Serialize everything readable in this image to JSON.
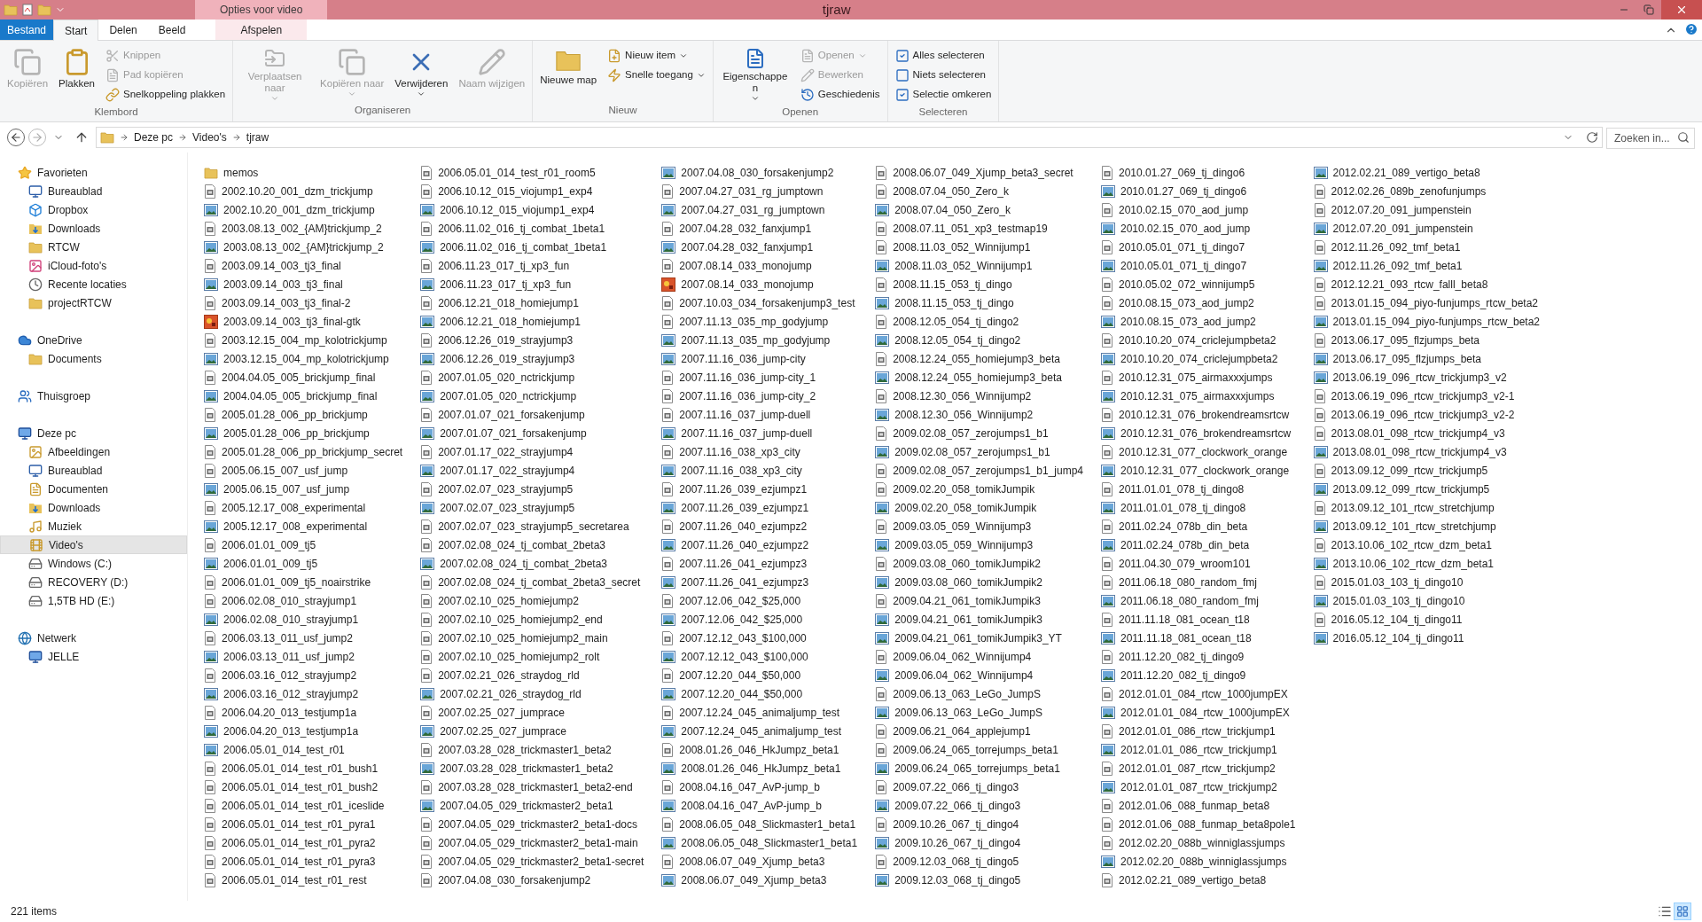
{
  "window": {
    "title": "tjraw",
    "context_label": "Opties voor video"
  },
  "tabs": [
    {
      "label": "Bestand",
      "kind": "file",
      "selected": false
    },
    {
      "label": "Start",
      "kind": "tab",
      "selected": true
    },
    {
      "label": "Delen",
      "kind": "tab",
      "selected": false
    },
    {
      "label": "Beeld",
      "kind": "tab",
      "selected": false
    },
    {
      "label": "Afspelen",
      "kind": "context",
      "selected": false
    }
  ],
  "ribbon": {
    "groups": [
      {
        "label": "Klembord",
        "buttons": [
          {
            "label": "Kopiëren",
            "kind": "large",
            "disabled": true,
            "menu": false
          },
          {
            "label": "Plakken",
            "kind": "large",
            "disabled": false,
            "menu": false
          },
          {
            "label": "Knippen",
            "kind": "small",
            "disabled": true,
            "menu": false
          },
          {
            "label": "Pad kopiëren",
            "kind": "small",
            "disabled": true,
            "menu": false
          },
          {
            "label": "Snelkoppeling plakken",
            "kind": "small",
            "disabled": false,
            "menu": false
          }
        ]
      },
      {
        "label": "Organiseren",
        "buttons": [
          {
            "label": "Verplaatsen naar",
            "kind": "large",
            "disabled": true,
            "menu": true
          },
          {
            "label": "Kopiëren naar",
            "kind": "large",
            "disabled": true,
            "menu": true
          },
          {
            "label": "Verwijderen",
            "kind": "large",
            "disabled": false,
            "menu": true
          },
          {
            "label": "Naam wijzigen",
            "kind": "large",
            "disabled": true,
            "menu": false
          }
        ]
      },
      {
        "label": "Nieuw",
        "buttons": [
          {
            "label": "Nieuwe map",
            "kind": "large",
            "disabled": false,
            "menu": false
          },
          {
            "label": "Nieuw item",
            "kind": "small",
            "disabled": false,
            "menu": true
          },
          {
            "label": "Snelle toegang",
            "kind": "small",
            "disabled": false,
            "menu": true
          }
        ]
      },
      {
        "label": "Openen",
        "buttons": [
          {
            "label": "Eigenschappen",
            "kind": "large",
            "disabled": false,
            "menu": true
          },
          {
            "label": "Openen",
            "kind": "small",
            "disabled": true,
            "menu": true
          },
          {
            "label": "Bewerken",
            "kind": "small",
            "disabled": true,
            "menu": false
          },
          {
            "label": "Geschiedenis",
            "kind": "small",
            "disabled": false,
            "menu": false
          }
        ]
      },
      {
        "label": "Selecteren",
        "buttons": [
          {
            "label": "Alles selecteren",
            "kind": "small",
            "disabled": false,
            "menu": false
          },
          {
            "label": "Niets selecteren",
            "kind": "small",
            "disabled": false,
            "menu": false
          },
          {
            "label": "Selectie omkeren",
            "kind": "small",
            "disabled": false,
            "menu": false
          }
        ]
      }
    ]
  },
  "address_bar": {
    "crumbs": [
      "Deze pc",
      "Video's",
      "tjraw"
    ],
    "search": {
      "placeholder": "Zoeken in..."
    }
  },
  "sidebar": {
    "sections": [
      {
        "label": "Favorieten",
        "kind": "star",
        "selected": false,
        "children": [
          {
            "label": "Bureaublad",
            "kind": "desktop",
            "selected": false
          },
          {
            "label": "Dropbox",
            "kind": "dropbox",
            "selected": false
          },
          {
            "label": "Downloads",
            "kind": "downloads",
            "selected": false
          },
          {
            "label": "RTCW",
            "kind": "folder",
            "selected": false
          },
          {
            "label": "iCloud-foto's",
            "kind": "photos",
            "selected": false
          },
          {
            "label": "Recente locaties",
            "kind": "recent",
            "selected": false
          },
          {
            "label": "projectRTCW",
            "kind": "folder",
            "selected": false
          }
        ]
      },
      {
        "label": "OneDrive",
        "kind": "cloud",
        "selected": false,
        "children": [
          {
            "label": "Documents",
            "kind": "folder",
            "selected": false
          }
        ]
      },
      {
        "label": "Thuisgroep",
        "kind": "homegroup",
        "selected": false
      },
      {
        "label": "Deze pc",
        "kind": "pc",
        "selected": false,
        "children": [
          {
            "label": "Afbeeldingen",
            "kind": "pictures",
            "selected": false
          },
          {
            "label": "Bureaublad",
            "kind": "desktop",
            "selected": false
          },
          {
            "label": "Documenten",
            "kind": "documents",
            "selected": false
          },
          {
            "label": "Downloads",
            "kind": "downloads",
            "selected": false
          },
          {
            "label": "Muziek",
            "kind": "music",
            "selected": false
          },
          {
            "label": "Video's",
            "kind": "videos",
            "selected": true
          },
          {
            "label": "Windows (C:)",
            "kind": "windrive",
            "selected": false
          },
          {
            "label": "RECOVERY (D:)",
            "kind": "drive",
            "selected": false
          },
          {
            "label": "1,5TB HD (E:)",
            "kind": "drive",
            "selected": false
          }
        ]
      },
      {
        "label": "Netwerk",
        "kind": "network",
        "selected": false,
        "children": [
          {
            "label": "JELLE",
            "kind": "computer",
            "selected": false
          }
        ]
      }
    ]
  },
  "files": [
    {
      "name": "memos",
      "kind": "folder"
    },
    {
      "name": "2002.10.20_001_dzm_trickjump",
      "kind": "file"
    },
    {
      "name": "2002.10.20_001_dzm_trickjump",
      "kind": "image"
    },
    {
      "name": "2003.08.13_002_{AM}trickjump_2",
      "kind": "file"
    },
    {
      "name": "2003.08.13_002_{AM}trickjump_2",
      "kind": "image"
    },
    {
      "name": "2003.09.14_003_tj3_final",
      "kind": "file"
    },
    {
      "name": "2003.09.14_003_tj3_final",
      "kind": "image"
    },
    {
      "name": "2003.09.14_003_tj3_final-2",
      "kind": "file"
    },
    {
      "name": "2003.09.14_003_tj3_final-gtk",
      "kind": "app"
    },
    {
      "name": "2003.12.15_004_mp_kolotrickjump",
      "kind": "file"
    },
    {
      "name": "2003.12.15_004_mp_kolotrickjump",
      "kind": "image"
    },
    {
      "name": "2004.04.05_005_brickjump_final",
      "kind": "file"
    },
    {
      "name": "2004.04.05_005_brickjump_final",
      "kind": "image"
    },
    {
      "name": "2005.01.28_006_pp_brickjump",
      "kind": "file"
    },
    {
      "name": "2005.01.28_006_pp_brickjump",
      "kind": "image"
    },
    {
      "name": "2005.01.28_006_pp_brickjump_secret",
      "kind": "file"
    },
    {
      "name": "2005.06.15_007_usf_jump",
      "kind": "file"
    },
    {
      "name": "2005.06.15_007_usf_jump",
      "kind": "image"
    },
    {
      "name": "2005.12.17_008_experimental",
      "kind": "file"
    },
    {
      "name": "2005.12.17_008_experimental",
      "kind": "image"
    },
    {
      "name": "2006.01.01_009_tj5",
      "kind": "file"
    },
    {
      "name": "2006.01.01_009_tj5",
      "kind": "image"
    },
    {
      "name": "2006.01.01_009_tj5_noairstrike",
      "kind": "file"
    },
    {
      "name": "2006.02.08_010_strayjump1",
      "kind": "file"
    },
    {
      "name": "2006.02.08_010_strayjump1",
      "kind": "image"
    },
    {
      "name": "2006.03.13_011_usf_jump2",
      "kind": "file"
    },
    {
      "name": "2006.03.13_011_usf_jump2",
      "kind": "image"
    },
    {
      "name": "2006.03.16_012_strayjump2",
      "kind": "file"
    },
    {
      "name": "2006.03.16_012_strayjump2",
      "kind": "image"
    },
    {
      "name": "2006.04.20_013_testjump1a",
      "kind": "file"
    },
    {
      "name": "2006.04.20_013_testjump1a",
      "kind": "image"
    },
    {
      "name": "2006.05.01_014_test_r01",
      "kind": "image"
    },
    {
      "name": "2006.05.01_014_test_r01_bush1",
      "kind": "file"
    },
    {
      "name": "2006.05.01_014_test_r01_bush2",
      "kind": "file"
    },
    {
      "name": "2006.05.01_014_test_r01_iceslide",
      "kind": "file"
    },
    {
      "name": "2006.05.01_014_test_r01_pyra1",
      "kind": "file"
    },
    {
      "name": "2006.05.01_014_test_r01_pyra2",
      "kind": "file"
    },
    {
      "name": "2006.05.01_014_test_r01_pyra3",
      "kind": "file"
    },
    {
      "name": "2006.05.01_014_test_r01_rest",
      "kind": "file"
    },
    {
      "name": "2006.05.01_014_test_r01_room5",
      "kind": "file"
    },
    {
      "name": "2006.10.12_015_viojump1_exp4",
      "kind": "file"
    },
    {
      "name": "2006.10.12_015_viojump1_exp4",
      "kind": "image"
    },
    {
      "name": "2006.11.02_016_tj_combat_1beta1",
      "kind": "file"
    },
    {
      "name": "2006.11.02_016_tj_combat_1beta1",
      "kind": "image"
    },
    {
      "name": "2006.11.23_017_tj_xp3_fun",
      "kind": "file"
    },
    {
      "name": "2006.11.23_017_tj_xp3_fun",
      "kind": "image"
    },
    {
      "name": "2006.12.21_018_homiejump1",
      "kind": "file"
    },
    {
      "name": "2006.12.21_018_homiejump1",
      "kind": "image"
    },
    {
      "name": "2006.12.26_019_strayjump3",
      "kind": "file"
    },
    {
      "name": "2006.12.26_019_strayjump3",
      "kind": "image"
    },
    {
      "name": "2007.01.05_020_nctrickjump",
      "kind": "file"
    },
    {
      "name": "2007.01.05_020_nctrickjump",
      "kind": "image"
    },
    {
      "name": "2007.01.07_021_forsakenjump",
      "kind": "file"
    },
    {
      "name": "2007.01.07_021_forsakenjump",
      "kind": "image"
    },
    {
      "name": "2007.01.17_022_strayjump4",
      "kind": "file"
    },
    {
      "name": "2007.01.17_022_strayjump4",
      "kind": "image"
    },
    {
      "name": "2007.02.07_023_strayjump5",
      "kind": "file"
    },
    {
      "name": "2007.02.07_023_strayjump5",
      "kind": "image"
    },
    {
      "name": "2007.02.07_023_strayjump5_secretarea",
      "kind": "file"
    },
    {
      "name": "2007.02.08_024_tj_combat_2beta3",
      "kind": "file"
    },
    {
      "name": "2007.02.08_024_tj_combat_2beta3",
      "kind": "image"
    },
    {
      "name": "2007.02.08_024_tj_combat_2beta3_secret",
      "kind": "file"
    },
    {
      "name": "2007.02.10_025_homiejump2",
      "kind": "file"
    },
    {
      "name": "2007.02.10_025_homiejump2_end",
      "kind": "file"
    },
    {
      "name": "2007.02.10_025_homiejump2_main",
      "kind": "file"
    },
    {
      "name": "2007.02.10_025_homiejump2_rolt",
      "kind": "file"
    },
    {
      "name": "2007.02.21_026_straydog_rld",
      "kind": "file"
    },
    {
      "name": "2007.02.21_026_straydog_rld",
      "kind": "image"
    },
    {
      "name": "2007.02.25_027_jumprace",
      "kind": "file"
    },
    {
      "name": "2007.02.25_027_jumprace",
      "kind": "image"
    },
    {
      "name": "2007.03.28_028_trickmaster1_beta2",
      "kind": "file"
    },
    {
      "name": "2007.03.28_028_trickmaster1_beta2",
      "kind": "image"
    },
    {
      "name": "2007.03.28_028_trickmaster1_beta2-end",
      "kind": "file"
    },
    {
      "name": "2007.04.05_029_trickmaster2_beta1",
      "kind": "image"
    },
    {
      "name": "2007.04.05_029_trickmaster2_beta1-docs",
      "kind": "file"
    },
    {
      "name": "2007.04.05_029_trickmaster2_beta1-main",
      "kind": "file"
    },
    {
      "name": "2007.04.05_029_trickmaster2_beta1-secret",
      "kind": "file"
    },
    {
      "name": "2007.04.08_030_forsakenjump2",
      "kind": "file"
    },
    {
      "name": "2007.04.08_030_forsakenjump2",
      "kind": "image"
    },
    {
      "name": "2007.04.27_031_rg_jumptown",
      "kind": "file"
    },
    {
      "name": "2007.04.27_031_rg_jumptown",
      "kind": "image"
    },
    {
      "name": "2007.04.28_032_fanxjump1",
      "kind": "file"
    },
    {
      "name": "2007.04.28_032_fanxjump1",
      "kind": "image"
    },
    {
      "name": "2007.08.14_033_monojump",
      "kind": "file"
    },
    {
      "name": "2007.08.14_033_monojump",
      "kind": "app"
    },
    {
      "name": "2007.10.03_034_forsakenjump3_test",
      "kind": "file"
    },
    {
      "name": "2007.11.13_035_mp_godyjump",
      "kind": "file"
    },
    {
      "name": "2007.11.13_035_mp_godyjump",
      "kind": "image"
    },
    {
      "name": "2007.11.16_036_jump-city",
      "kind": "image"
    },
    {
      "name": "2007.11.16_036_jump-city_1",
      "kind": "file"
    },
    {
      "name": "2007.11.16_036_jump-city_2",
      "kind": "file"
    },
    {
      "name": "2007.11.16_037_jump-duell",
      "kind": "file"
    },
    {
      "name": "2007.11.16_037_jump-duell",
      "kind": "image"
    },
    {
      "name": "2007.11.16_038_xp3_city",
      "kind": "file"
    },
    {
      "name": "2007.11.16_038_xp3_city",
      "kind": "image"
    },
    {
      "name": "2007.11.26_039_ezjumpz1",
      "kind": "file"
    },
    {
      "name": "2007.11.26_039_ezjumpz1",
      "kind": "image"
    },
    {
      "name": "2007.11.26_040_ezjumpz2",
      "kind": "file"
    },
    {
      "name": "2007.11.26_040_ezjumpz2",
      "kind": "image"
    },
    {
      "name": "2007.11.26_041_ezjumpz3",
      "kind": "file"
    },
    {
      "name": "2007.11.26_041_ezjumpz3",
      "kind": "image"
    },
    {
      "name": "2007.12.06_042_$25,000",
      "kind": "file"
    },
    {
      "name": "2007.12.06_042_$25,000",
      "kind": "image"
    },
    {
      "name": "2007.12.12_043_$100,000",
      "kind": "file"
    },
    {
      "name": "2007.12.12_043_$100,000",
      "kind": "image"
    },
    {
      "name": "2007.12.20_044_$50,000",
      "kind": "file"
    },
    {
      "name": "2007.12.20_044_$50,000",
      "kind": "image"
    },
    {
      "name": "2007.12.24_045_animaljump_test",
      "kind": "file"
    },
    {
      "name": "2007.12.24_045_animaljump_test",
      "kind": "image"
    },
    {
      "name": "2008.01.26_046_HkJumpz_beta1",
      "kind": "file"
    },
    {
      "name": "2008.01.26_046_HkJumpz_beta1",
      "kind": "image"
    },
    {
      "name": "2008.04.16_047_AvP-jump_b",
      "kind": "file"
    },
    {
      "name": "2008.04.16_047_AvP-jump_b",
      "kind": "image"
    },
    {
      "name": "2008.06.05_048_Slickmaster1_beta1",
      "kind": "file"
    },
    {
      "name": "2008.06.05_048_Slickmaster1_beta1",
      "kind": "image"
    },
    {
      "name": "2008.06.07_049_Xjump_beta3",
      "kind": "file"
    },
    {
      "name": "2008.06.07_049_Xjump_beta3",
      "kind": "image"
    },
    {
      "name": "2008.06.07_049_Xjump_beta3_secret",
      "kind": "file"
    },
    {
      "name": "2008.07.04_050_Zero_k",
      "kind": "file"
    },
    {
      "name": "2008.07.04_050_Zero_k",
      "kind": "image"
    },
    {
      "name": "2008.07.11_051_xp3_testmap19",
      "kind": "file"
    },
    {
      "name": "2008.11.03_052_Winnijump1",
      "kind": "file"
    },
    {
      "name": "2008.11.03_052_Winnijump1",
      "kind": "image"
    },
    {
      "name": "2008.11.15_053_tj_dingo",
      "kind": "file"
    },
    {
      "name": "2008.11.15_053_tj_dingo",
      "kind": "image"
    },
    {
      "name": "2008.12.05_054_tj_dingo2",
      "kind": "file"
    },
    {
      "name": "2008.12.05_054_tj_dingo2",
      "kind": "image"
    },
    {
      "name": "2008.12.24_055_homiejump3_beta",
      "kind": "file"
    },
    {
      "name": "2008.12.24_055_homiejump3_beta",
      "kind": "image"
    },
    {
      "name": "2008.12.30_056_Winnijump2",
      "kind": "file"
    },
    {
      "name": "2008.12.30_056_Winnijump2",
      "kind": "image"
    },
    {
      "name": "2009.02.08_057_zerojumps1_b1",
      "kind": "file"
    },
    {
      "name": "2009.02.08_057_zerojumps1_b1",
      "kind": "image"
    },
    {
      "name": "2009.02.08_057_zerojumps1_b1_jump4",
      "kind": "file"
    },
    {
      "name": "2009.02.20_058_tomikJumpik",
      "kind": "file"
    },
    {
      "name": "2009.02.20_058_tomikJumpik",
      "kind": "image"
    },
    {
      "name": "2009.03.05_059_Winnijump3",
      "kind": "file"
    },
    {
      "name": "2009.03.05_059_Winnijump3",
      "kind": "image"
    },
    {
      "name": "2009.03.08_060_tomikJumpik2",
      "kind": "file"
    },
    {
      "name": "2009.03.08_060_tomikJumpik2",
      "kind": "image"
    },
    {
      "name": "2009.04.21_061_tomikJumpik3",
      "kind": "file"
    },
    {
      "name": "2009.04.21_061_tomikJumpik3",
      "kind": "image"
    },
    {
      "name": "2009.04.21_061_tomikJumpik3_YT",
      "kind": "image"
    },
    {
      "name": "2009.06.04_062_Winnijump4",
      "kind": "file"
    },
    {
      "name": "2009.06.04_062_Winnijump4",
      "kind": "image"
    },
    {
      "name": "2009.06.13_063_LeGo_JumpS",
      "kind": "file"
    },
    {
      "name": "2009.06.13_063_LeGo_JumpS",
      "kind": "image"
    },
    {
      "name": "2009.06.21_064_applejump1",
      "kind": "file"
    },
    {
      "name": "2009.06.24_065_torrejumps_beta1",
      "kind": "file"
    },
    {
      "name": "2009.06.24_065_torrejumps_beta1",
      "kind": "image"
    },
    {
      "name": "2009.07.22_066_tj_dingo3",
      "kind": "file"
    },
    {
      "name": "2009.07.22_066_tj_dingo3",
      "kind": "image"
    },
    {
      "name": "2009.10.26_067_tj_dingo4",
      "kind": "file"
    },
    {
      "name": "2009.10.26_067_tj_dingo4",
      "kind": "image"
    },
    {
      "name": "2009.12.03_068_tj_dingo5",
      "kind": "file"
    },
    {
      "name": "2009.12.03_068_tj_dingo5",
      "kind": "image"
    },
    {
      "name": "2010.01.27_069_tj_dingo6",
      "kind": "file"
    },
    {
      "name": "2010.01.27_069_tj_dingo6",
      "kind": "image"
    },
    {
      "name": "2010.02.15_070_aod_jump",
      "kind": "file"
    },
    {
      "name": "2010.02.15_070_aod_jump",
      "kind": "image"
    },
    {
      "name": "2010.05.01_071_tj_dingo7",
      "kind": "file"
    },
    {
      "name": "2010.05.01_071_tj_dingo7",
      "kind": "image"
    },
    {
      "name": "2010.05.02_072_winnijump5",
      "kind": "file"
    },
    {
      "name": "2010.08.15_073_aod_jump2",
      "kind": "file"
    },
    {
      "name": "2010.08.15_073_aod_jump2",
      "kind": "image"
    },
    {
      "name": "2010.10.20_074_criclejumpbeta2",
      "kind": "file"
    },
    {
      "name": "2010.10.20_074_criclejumpbeta2",
      "kind": "image"
    },
    {
      "name": "2010.12.31_075_airmaxxxjumps",
      "kind": "file"
    },
    {
      "name": "2010.12.31_075_airmaxxxjumps",
      "kind": "image"
    },
    {
      "name": "2010.12.31_076_brokendreamsrtcw",
      "kind": "file"
    },
    {
      "name": "2010.12.31_076_brokendreamsrtcw",
      "kind": "image"
    },
    {
      "name": "2010.12.31_077_clockwork_orange",
      "kind": "file"
    },
    {
      "name": "2010.12.31_077_clockwork_orange",
      "kind": "image"
    },
    {
      "name": "2011.01.01_078_tj_dingo8",
      "kind": "file"
    },
    {
      "name": "2011.01.01_078_tj_dingo8",
      "kind": "image"
    },
    {
      "name": "2011.02.24_078b_din_beta",
      "kind": "file"
    },
    {
      "name": "2011.02.24_078b_din_beta",
      "kind": "image"
    },
    {
      "name": "2011.04.30_079_wroom101",
      "kind": "file"
    },
    {
      "name": "2011.06.18_080_random_fmj",
      "kind": "file"
    },
    {
      "name": "2011.06.18_080_random_fmj",
      "kind": "image"
    },
    {
      "name": "2011.11.18_081_ocean_t18",
      "kind": "file"
    },
    {
      "name": "2011.11.18_081_ocean_t18",
      "kind": "image"
    },
    {
      "name": "2011.12.20_082_tj_dingo9",
      "kind": "file"
    },
    {
      "name": "2011.12.20_082_tj_dingo9",
      "kind": "image"
    },
    {
      "name": "2012.01.01_084_rtcw_1000jumpEX",
      "kind": "file"
    },
    {
      "name": "2012.01.01_084_rtcw_1000jumpEX",
      "kind": "image"
    },
    {
      "name": "2012.01.01_086_rtcw_trickjump1",
      "kind": "file"
    },
    {
      "name": "2012.01.01_086_rtcw_trickjump1",
      "kind": "image"
    },
    {
      "name": "2012.01.01_087_rtcw_trickjump2",
      "kind": "file"
    },
    {
      "name": "2012.01.01_087_rtcw_trickjump2",
      "kind": "image"
    },
    {
      "name": "2012.01.06_088_funmap_beta8",
      "kind": "file"
    },
    {
      "name": "2012.01.06_088_funmap_beta8pole1",
      "kind": "file"
    },
    {
      "name": "2012.02.20_088b_winniglassjumps",
      "kind": "file"
    },
    {
      "name": "2012.02.20_088b_winniglassjumps",
      "kind": "image"
    },
    {
      "name": "2012.02.21_089_vertigo_beta8",
      "kind": "file"
    },
    {
      "name": "2012.02.21_089_vertigo_beta8",
      "kind": "image"
    },
    {
      "name": "2012.02.26_089b_zenofunjumps",
      "kind": "file"
    },
    {
      "name": "2012.07.20_091_jumpenstein",
      "kind": "file"
    },
    {
      "name": "2012.07.20_091_jumpenstein",
      "kind": "image"
    },
    {
      "name": "2012.11.26_092_tmf_beta1",
      "kind": "file"
    },
    {
      "name": "2012.11.26_092_tmf_beta1",
      "kind": "image"
    },
    {
      "name": "2012.12.21_093_rtcw_falll_beta8",
      "kind": "file"
    },
    {
      "name": "2013.01.15_094_piyo-funjumps_rtcw_beta2",
      "kind": "file"
    },
    {
      "name": "2013.01.15_094_piyo-funjumps_rtcw_beta2",
      "kind": "image"
    },
    {
      "name": "2013.06.17_095_flzjumps_beta",
      "kind": "file"
    },
    {
      "name": "2013.06.17_095_flzjumps_beta",
      "kind": "image"
    },
    {
      "name": "2013.06.19_096_rtcw_trickjump3_v2",
      "kind": "image"
    },
    {
      "name": "2013.06.19_096_rtcw_trickjump3_v2-1",
      "kind": "file"
    },
    {
      "name": "2013.06.19_096_rtcw_trickjump3_v2-2",
      "kind": "file"
    },
    {
      "name": "2013.08.01_098_rtcw_trickjump4_v3",
      "kind": "file"
    },
    {
      "name": "2013.08.01_098_rtcw_trickjump4_v3",
      "kind": "image"
    },
    {
      "name": "2013.09.12_099_rtcw_trickjump5",
      "kind": "file"
    },
    {
      "name": "2013.09.12_099_rtcw_trickjump5",
      "kind": "image"
    },
    {
      "name": "2013.09.12_101_rtcw_stretchjump",
      "kind": "file"
    },
    {
      "name": "2013.09.12_101_rtcw_stretchjump",
      "kind": "image"
    },
    {
      "name": "2013.10.06_102_rtcw_dzm_beta1",
      "kind": "file"
    },
    {
      "name": "2013.10.06_102_rtcw_dzm_beta1",
      "kind": "image"
    },
    {
      "name": "2015.01.03_103_tj_dingo10",
      "kind": "file"
    },
    {
      "name": "2015.01.03_103_tj_dingo10",
      "kind": "image"
    },
    {
      "name": "2016.05.12_104_tj_dingo11",
      "kind": "file"
    },
    {
      "name": "2016.05.12_104_tj_dingo11",
      "kind": "image"
    }
  ],
  "status_bar": {
    "count": "221 items",
    "views": [
      {
        "kind": "details",
        "selected": false
      },
      {
        "kind": "icons",
        "selected": true
      }
    ]
  }
}
